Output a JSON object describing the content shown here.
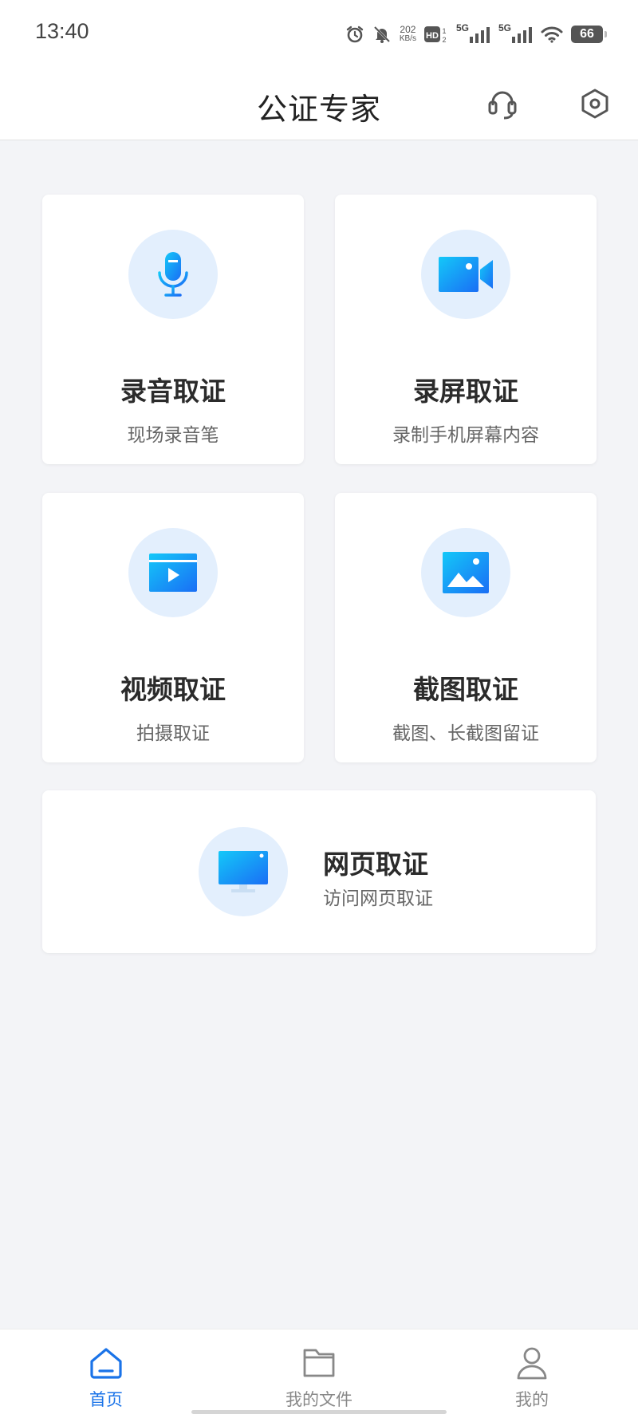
{
  "status_bar": {
    "time": "13:40",
    "net_speed_value": "202",
    "net_speed_unit": "KB/s",
    "hd_label": "HD",
    "hd_sub": "1\n2",
    "sig1_label": "5G",
    "sig2_label": "5G",
    "battery": "66",
    "icons": [
      "alarm-icon",
      "mute-bell-icon",
      "hd-icon",
      "signal-icon",
      "signal-icon",
      "wifi-icon",
      "battery-icon"
    ]
  },
  "header": {
    "title": "公证专家",
    "support_icon": "headset-icon",
    "settings_icon": "settings-hexagon-icon"
  },
  "cards": [
    {
      "title": "录音取证",
      "subtitle": "现场录音笔",
      "icon": "microphone-icon"
    },
    {
      "title": "录屏取证",
      "subtitle": "录制手机屏幕内容",
      "icon": "video-camera-icon"
    },
    {
      "title": "视频取证",
      "subtitle": "拍摄取证",
      "icon": "video-player-icon"
    },
    {
      "title": "截图取证",
      "subtitle": "截图、长截图留证",
      "icon": "image-icon"
    },
    {
      "title": "网页取证",
      "subtitle": "访问网页取证",
      "icon": "monitor-icon"
    }
  ],
  "bottom_nav": {
    "items": [
      {
        "label": "首页",
        "icon": "home-icon",
        "active": true
      },
      {
        "label": "我的文件",
        "icon": "folder-icon",
        "active": false
      },
      {
        "label": "我的",
        "icon": "user-icon",
        "active": false
      }
    ]
  },
  "colors": {
    "accent": "#1a73e8",
    "icon_gradient_start": "#14c8f8",
    "icon_gradient_end": "#1a6ef5",
    "icon_circle_bg": "#e3effd",
    "page_bg": "#f3f4f7"
  }
}
